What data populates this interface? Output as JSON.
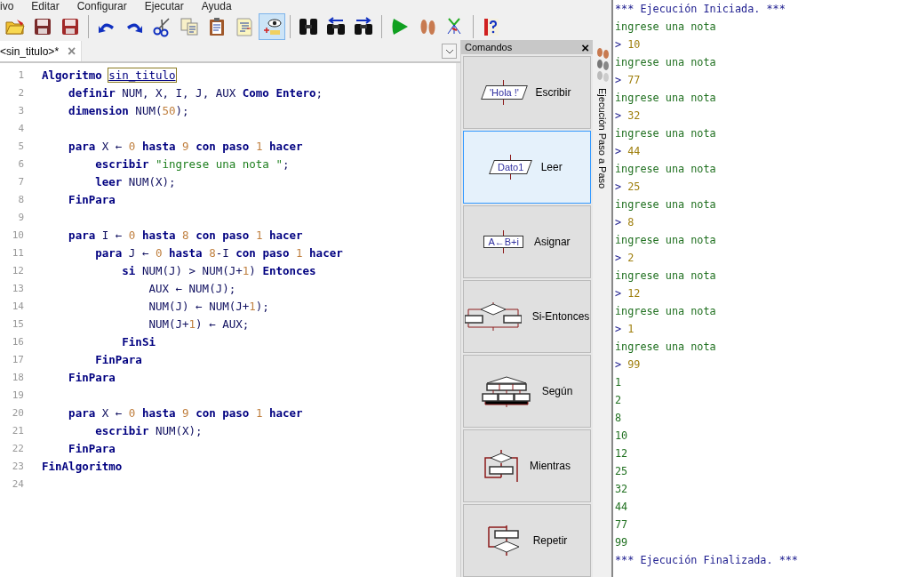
{
  "menu": [
    "ivo",
    "Editar",
    "Configurar",
    "Ejecutar",
    "Ayuda"
  ],
  "toolbar": [
    [
      {
        "kind": "open",
        "selected": false
      },
      {
        "kind": "save",
        "selected": false
      },
      {
        "kind": "save-as",
        "selected": false
      }
    ],
    [
      {
        "kind": "undo",
        "selected": false
      },
      {
        "kind": "redo",
        "selected": false
      },
      {
        "kind": "cut",
        "selected": false
      },
      {
        "kind": "copy",
        "selected": false
      },
      {
        "kind": "paste",
        "selected": false
      },
      {
        "kind": "indent",
        "selected": false
      },
      {
        "kind": "watch",
        "selected": true
      }
    ],
    [
      {
        "kind": "find",
        "selected": false
      },
      {
        "kind": "find-prev",
        "selected": false
      },
      {
        "kind": "find-next",
        "selected": false
      }
    ],
    [
      {
        "kind": "run",
        "selected": false
      },
      {
        "kind": "step",
        "selected": false
      },
      {
        "kind": "flowchart",
        "selected": false
      }
    ],
    [
      {
        "kind": "help",
        "selected": false
      }
    ]
  ],
  "editor": {
    "tab": {
      "label": "<sin_titulo>*",
      "close": "×"
    },
    "lines": [
      {
        "number": "1",
        "tokens": [
          {
            "kind": "kw",
            "text": "Algoritmo "
          },
          {
            "kind": "name",
            "text": "sin_titulo"
          }
        ]
      },
      {
        "number": "2",
        "tokens": [
          {
            "kind": "kw",
            "text": "    definir"
          },
          {
            "kind": "text",
            "text": " NUM, X, I, J, AUX "
          },
          {
            "kind": "kw",
            "text": "Como Entero"
          },
          {
            "kind": "text",
            "text": ";"
          }
        ]
      },
      {
        "number": "3",
        "tokens": [
          {
            "kind": "kw",
            "text": "    dimension"
          },
          {
            "kind": "text",
            "text": " NUM("
          },
          {
            "kind": "num",
            "text": "50"
          },
          {
            "kind": "text",
            "text": ");"
          }
        ]
      },
      {
        "number": "4"
      },
      {
        "number": "5",
        "tokens": [
          {
            "kind": "kw",
            "text": "    para"
          },
          {
            "kind": "text",
            "text": " X ← "
          },
          {
            "kind": "num",
            "text": "0"
          },
          {
            "kind": "kw",
            "text": " hasta "
          },
          {
            "kind": "num",
            "text": "9"
          },
          {
            "kind": "kw",
            "text": " con paso "
          },
          {
            "kind": "num",
            "text": "1"
          },
          {
            "kind": "kw",
            "text": " hacer"
          }
        ]
      },
      {
        "number": "6",
        "tokens": [
          {
            "kind": "kw",
            "text": "        escribir"
          },
          {
            "kind": "str",
            "text": " \"ingrese una nota \""
          },
          {
            "kind": "text",
            "text": ";"
          }
        ]
      },
      {
        "number": "7",
        "tokens": [
          {
            "kind": "kw",
            "text": "        leer"
          },
          {
            "kind": "text",
            "text": " NUM(X);"
          }
        ]
      },
      {
        "number": "8",
        "tokens": [
          {
            "kind": "kw",
            "text": "    FinPara"
          }
        ]
      },
      {
        "number": "9"
      },
      {
        "number": "10",
        "tokens": [
          {
            "kind": "kw",
            "text": "    para"
          },
          {
            "kind": "text",
            "text": " I ← "
          },
          {
            "kind": "num",
            "text": "0"
          },
          {
            "kind": "kw",
            "text": " hasta "
          },
          {
            "kind": "num",
            "text": "8"
          },
          {
            "kind": "kw",
            "text": " con paso "
          },
          {
            "kind": "num",
            "text": "1"
          },
          {
            "kind": "kw",
            "text": " hacer"
          }
        ]
      },
      {
        "number": "11",
        "tokens": [
          {
            "kind": "kw",
            "text": "        para"
          },
          {
            "kind": "text",
            "text": " J ← "
          },
          {
            "kind": "num",
            "text": "0"
          },
          {
            "kind": "kw",
            "text": " hasta "
          },
          {
            "kind": "num",
            "text": "8"
          },
          {
            "kind": "text",
            "text": "-I"
          },
          {
            "kind": "kw",
            "text": " con paso "
          },
          {
            "kind": "num",
            "text": "1"
          },
          {
            "kind": "kw",
            "text": " hacer"
          }
        ]
      },
      {
        "number": "12",
        "tokens": [
          {
            "kind": "kw",
            "text": "            si"
          },
          {
            "kind": "text",
            "text": " NUM(J) > NUM(J+"
          },
          {
            "kind": "num",
            "text": "1"
          },
          {
            "kind": "text",
            "text": ") "
          },
          {
            "kind": "kw",
            "text": "Entonces"
          }
        ]
      },
      {
        "number": "13",
        "tokens": [
          {
            "kind": "text",
            "text": "                AUX ← NUM(J);"
          }
        ]
      },
      {
        "number": "14",
        "tokens": [
          {
            "kind": "text",
            "text": "                NUM(J) ← NUM(J+"
          },
          {
            "kind": "num",
            "text": "1"
          },
          {
            "kind": "text",
            "text": ");"
          }
        ]
      },
      {
        "number": "15",
        "tokens": [
          {
            "kind": "text",
            "text": "                NUM(J+"
          },
          {
            "kind": "num",
            "text": "1"
          },
          {
            "kind": "text",
            "text": ") ← AUX;"
          }
        ]
      },
      {
        "number": "16",
        "tokens": [
          {
            "kind": "kw",
            "text": "            FinSi"
          }
        ]
      },
      {
        "number": "17",
        "tokens": [
          {
            "kind": "kw",
            "text": "        FinPara"
          }
        ]
      },
      {
        "number": "18",
        "tokens": [
          {
            "kind": "kw",
            "text": "    FinPara"
          }
        ]
      },
      {
        "number": "19"
      },
      {
        "number": "20",
        "tokens": [
          {
            "kind": "kw",
            "text": "    para"
          },
          {
            "kind": "text",
            "text": " X ← "
          },
          {
            "kind": "num",
            "text": "0"
          },
          {
            "kind": "kw",
            "text": " hasta "
          },
          {
            "kind": "num",
            "text": "9"
          },
          {
            "kind": "kw",
            "text": " con paso "
          },
          {
            "kind": "num",
            "text": "1"
          },
          {
            "kind": "kw",
            "text": " hacer"
          }
        ]
      },
      {
        "number": "21",
        "tokens": [
          {
            "kind": "kw",
            "text": "        escribir"
          },
          {
            "kind": "text",
            "text": " NUM(X);"
          }
        ]
      },
      {
        "number": "22",
        "tokens": [
          {
            "kind": "kw",
            "text": "    FinPara"
          }
        ]
      },
      {
        "number": "23",
        "tokens": [
          {
            "kind": "kw",
            "text": "FinAlgoritmo"
          }
        ]
      },
      {
        "number": "24"
      }
    ]
  },
  "commands": {
    "title": "Comandos",
    "close": "×",
    "items": [
      {
        "kind": "write",
        "label": "Escribir",
        "diagram_text": "'Hola !'",
        "selected": false
      },
      {
        "kind": "read",
        "label": "Leer",
        "diagram_text": "Dato1",
        "selected": true
      },
      {
        "kind": "assign",
        "label": "Asignar",
        "diagram_text": "A←B+i",
        "selected": false
      },
      {
        "kind": "if",
        "label": "Si-Entonces",
        "selected": false
      },
      {
        "kind": "switch",
        "label": "Según",
        "selected": false
      },
      {
        "kind": "while",
        "label": "Mientras",
        "selected": false
      },
      {
        "kind": "repeat",
        "label": "Repetir",
        "selected": false
      }
    ]
  },
  "side_tab": {
    "label": "Ejecución Paso a Paso"
  },
  "console": [
    {
      "kind": "status",
      "text": "*** Ejecución Iniciada. ***"
    },
    {
      "kind": "prompt",
      "text": "ingrese una nota"
    },
    {
      "kind": "input",
      "marker": ">",
      "value": "10"
    },
    {
      "kind": "prompt",
      "text": "ingrese una nota"
    },
    {
      "kind": "input",
      "marker": ">",
      "value": "77"
    },
    {
      "kind": "prompt",
      "text": "ingrese una nota"
    },
    {
      "kind": "input",
      "marker": ">",
      "value": "32"
    },
    {
      "kind": "prompt",
      "text": "ingrese una nota"
    },
    {
      "kind": "input",
      "marker": ">",
      "value": "44"
    },
    {
      "kind": "prompt",
      "text": "ingrese una nota"
    },
    {
      "kind": "input",
      "marker": ">",
      "value": "25"
    },
    {
      "kind": "prompt",
      "text": "ingrese una nota"
    },
    {
      "kind": "input",
      "marker": ">",
      "value": "8"
    },
    {
      "kind": "prompt",
      "text": "ingrese una nota"
    },
    {
      "kind": "input",
      "marker": ">",
      "value": "2"
    },
    {
      "kind": "prompt",
      "text": "ingrese una nota"
    },
    {
      "kind": "input",
      "marker": ">",
      "value": "12"
    },
    {
      "kind": "prompt",
      "text": "ingrese una nota"
    },
    {
      "kind": "input",
      "marker": ">",
      "value": "1"
    },
    {
      "kind": "prompt",
      "text": "ingrese una nota"
    },
    {
      "kind": "input",
      "marker": ">",
      "value": "99"
    },
    {
      "kind": "output",
      "text": "1"
    },
    {
      "kind": "output",
      "text": "2"
    },
    {
      "kind": "output",
      "text": "8"
    },
    {
      "kind": "output",
      "text": "10"
    },
    {
      "kind": "output",
      "text": "12"
    },
    {
      "kind": "output",
      "text": "25"
    },
    {
      "kind": "output",
      "text": "32"
    },
    {
      "kind": "output",
      "text": "44"
    },
    {
      "kind": "output",
      "text": "77"
    },
    {
      "kind": "output",
      "text": "99"
    },
    {
      "kind": "status",
      "text": "*** Ejecución Finalizada. ***"
    }
  ]
}
